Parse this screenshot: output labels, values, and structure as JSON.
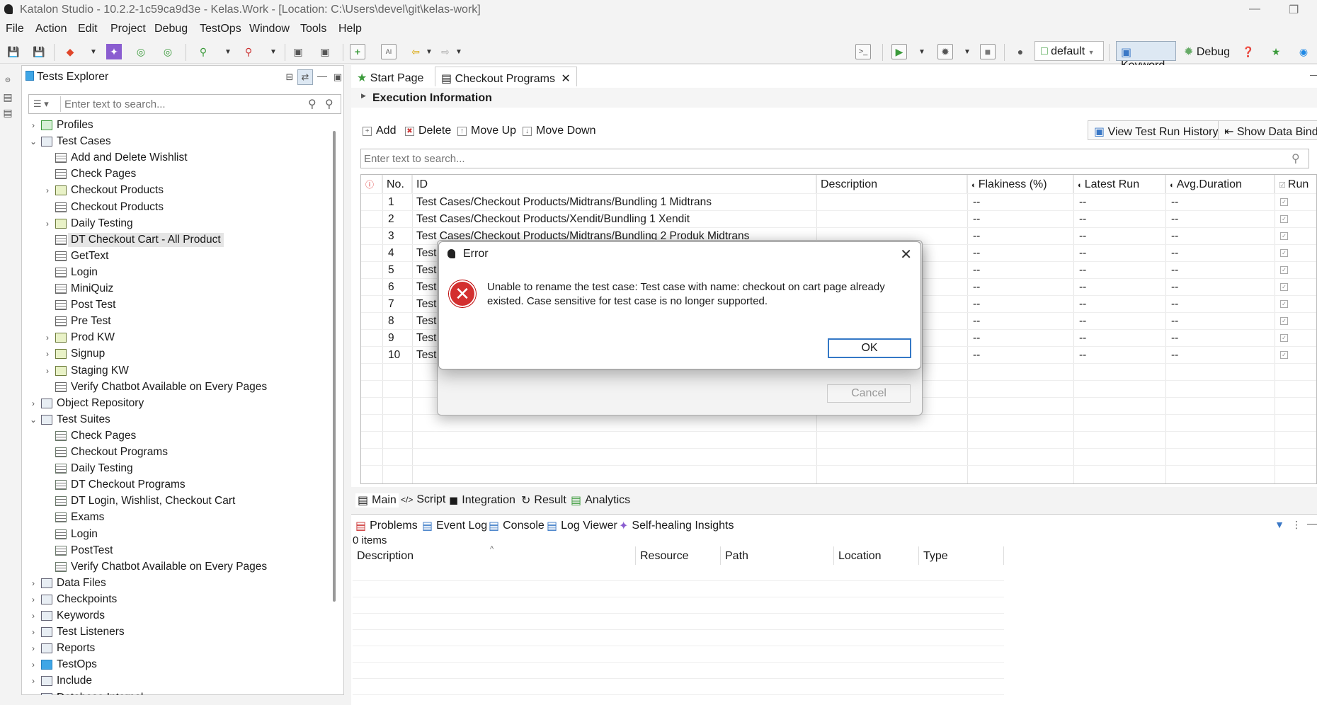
{
  "window": {
    "title": "Katalon Studio - 10.2.2-1c59ca9d3e - Kelas.Work - [Location: C:\\Users\\devel\\git\\kelas-work]"
  },
  "menu": [
    "File",
    "Action",
    "Edit",
    "Project",
    "Debug",
    "TestOps",
    "Window",
    "Tools",
    "Help"
  ],
  "toolbar": {
    "profile": "default",
    "keyword_label": "Keyword",
    "debug_label": "Debug"
  },
  "explorer": {
    "title": "Tests Explorer",
    "search_placeholder": "Enter text to search...",
    "items": [
      {
        "label": "Profiles",
        "depth": 0,
        "toggle": ">",
        "icon": "prof"
      },
      {
        "label": "Test Cases",
        "depth": 0,
        "toggle": "v",
        "icon": "repo"
      },
      {
        "label": "Add and Delete Wishlist",
        "depth": 1,
        "toggle": "",
        "icon": "tc"
      },
      {
        "label": "Check Pages",
        "depth": 1,
        "toggle": "",
        "icon": "tc"
      },
      {
        "label": "Checkout Products",
        "depth": 1,
        "toggle": ">",
        "icon": "folder"
      },
      {
        "label": "Checkout Products",
        "depth": 1,
        "toggle": "",
        "icon": "tc"
      },
      {
        "label": "Daily Testing",
        "depth": 1,
        "toggle": ">",
        "icon": "folder"
      },
      {
        "label": "DT Checkout Cart - All Product",
        "depth": 1,
        "toggle": "",
        "icon": "tc",
        "selected": true
      },
      {
        "label": "GetText",
        "depth": 1,
        "toggle": "",
        "icon": "tc"
      },
      {
        "label": "Login",
        "depth": 1,
        "toggle": "",
        "icon": "tc"
      },
      {
        "label": "MiniQuiz",
        "depth": 1,
        "toggle": "",
        "icon": "tc"
      },
      {
        "label": "Post Test",
        "depth": 1,
        "toggle": "",
        "icon": "tc"
      },
      {
        "label": "Pre Test",
        "depth": 1,
        "toggle": "",
        "icon": "tc"
      },
      {
        "label": "Prod KW",
        "depth": 1,
        "toggle": ">",
        "icon": "folder"
      },
      {
        "label": "Signup",
        "depth": 1,
        "toggle": ">",
        "icon": "folder"
      },
      {
        "label": "Staging KW",
        "depth": 1,
        "toggle": ">",
        "icon": "folder"
      },
      {
        "label": "Verify Chatbot Available on Every Pages",
        "depth": 1,
        "toggle": "",
        "icon": "tc"
      },
      {
        "label": "Object Repository",
        "depth": 0,
        "toggle": ">",
        "icon": "repo"
      },
      {
        "label": "Test Suites",
        "depth": 0,
        "toggle": "v",
        "icon": "repo"
      },
      {
        "label": "Check Pages",
        "depth": 1,
        "toggle": "",
        "icon": "suite"
      },
      {
        "label": "Checkout Programs",
        "depth": 1,
        "toggle": "",
        "icon": "suite"
      },
      {
        "label": "Daily Testing",
        "depth": 1,
        "toggle": "",
        "icon": "suite"
      },
      {
        "label": "DT Checkout Programs",
        "depth": 1,
        "toggle": "",
        "icon": "suite"
      },
      {
        "label": "DT Login, Wishlist, Checkout Cart",
        "depth": 1,
        "toggle": "",
        "icon": "suite"
      },
      {
        "label": "Exams",
        "depth": 1,
        "toggle": "",
        "icon": "suite"
      },
      {
        "label": "Login",
        "depth": 1,
        "toggle": "",
        "icon": "suite"
      },
      {
        "label": "PostTest",
        "depth": 1,
        "toggle": "",
        "icon": "suite"
      },
      {
        "label": "Verify Chatbot Available on Every Pages",
        "depth": 1,
        "toggle": "",
        "icon": "suite"
      },
      {
        "label": "Data Files",
        "depth": 0,
        "toggle": ">",
        "icon": "repo"
      },
      {
        "label": "Checkpoints",
        "depth": 0,
        "toggle": ">",
        "icon": "repo"
      },
      {
        "label": "Keywords",
        "depth": 0,
        "toggle": ">",
        "icon": "repo"
      },
      {
        "label": "Test Listeners",
        "depth": 0,
        "toggle": ">",
        "icon": "repo"
      },
      {
        "label": "Reports",
        "depth": 0,
        "toggle": ">",
        "icon": "repo"
      },
      {
        "label": "TestOps",
        "depth": 0,
        "toggle": ">",
        "icon": "ops"
      },
      {
        "label": "Include",
        "depth": 0,
        "toggle": ">",
        "icon": "repo"
      },
      {
        "label": "Database Internal",
        "depth": 0,
        "toggle": ">",
        "icon": "repo"
      }
    ]
  },
  "editor": {
    "tabs": [
      "Start Page",
      "Checkout Programs"
    ],
    "section": "Execution Information",
    "actions": [
      "Add",
      "Delete",
      "Move Up",
      "Move Down"
    ],
    "view_history": "View Test Run History",
    "show_binding": "Show Data Binding",
    "search_placeholder": "Enter text to search...",
    "columns": [
      "No.",
      "ID",
      "Description",
      "Flakiness (%)",
      "Latest Run",
      "Avg.Duration",
      "Run"
    ],
    "rows": [
      {
        "no": "1",
        "id": "Test Cases/Checkout Products/Midtrans/Bundling 1 Midtrans",
        "flak": "--",
        "latest": "--",
        "avg": "--"
      },
      {
        "no": "2",
        "id": "Test Cases/Checkout Products/Xendit/Bundling 1 Xendit",
        "flak": "--",
        "latest": "--",
        "avg": "--"
      },
      {
        "no": "3",
        "id": "Test Cases/Checkout Products/Midtrans/Bundling 2 Produk Midtrans",
        "flak": "--",
        "latest": "--",
        "avg": "--"
      },
      {
        "no": "4",
        "id": "Test",
        "flak": "--",
        "latest": "--",
        "avg": "--"
      },
      {
        "no": "5",
        "id": "Test",
        "flak": "--",
        "latest": "--",
        "avg": "--"
      },
      {
        "no": "6",
        "id": "Test",
        "flak": "--",
        "latest": "--",
        "avg": "--"
      },
      {
        "no": "7",
        "id": "Test",
        "flak": "--",
        "latest": "--",
        "avg": "--"
      },
      {
        "no": "8",
        "id": "Test",
        "flak": "--",
        "latest": "--",
        "avg": "--"
      },
      {
        "no": "9",
        "id": "Test",
        "flak": "--",
        "latest": "--",
        "avg": "--"
      },
      {
        "no": "10",
        "id": "Test",
        "flak": "--",
        "latest": "--",
        "avg": "--"
      }
    ],
    "bottom_tabs": [
      "Main",
      "Script",
      "Integration",
      "Result",
      "Analytics"
    ]
  },
  "problems": {
    "tabs": [
      "Problems",
      "Event Log",
      "Console",
      "Log Viewer",
      "Self-healing Insights"
    ],
    "count": "0 items",
    "columns": [
      "Description",
      "Resource",
      "Path",
      "Location",
      "Type"
    ]
  },
  "dialog": {
    "title": "Error",
    "message": "Unable to rename the test case: Test case with name: checkout on cart page already existed. Case sensitive for test case is no longer supported.",
    "ok": "OK",
    "cancel": "Cancel"
  }
}
